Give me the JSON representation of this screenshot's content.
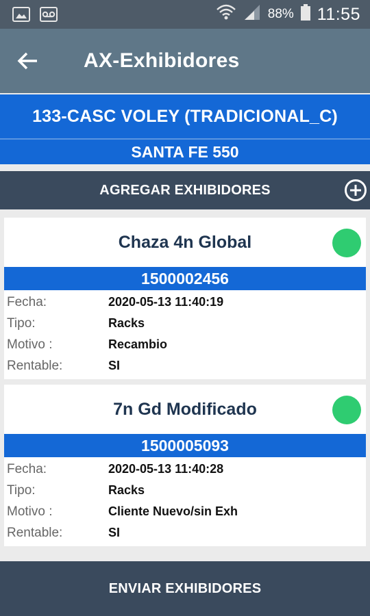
{
  "status_bar": {
    "battery": "88%",
    "time": "11:55"
  },
  "app_bar": {
    "title": "AX-Exhibidores"
  },
  "client": {
    "name": "133-CASC VOLEY (TRADICIONAL_C)",
    "address": "SANTA FE 550"
  },
  "add_bar": {
    "label": "AGREGAR EXHIBIDORES"
  },
  "labels": {
    "fecha": "Fecha:",
    "tipo": "Tipo:",
    "motivo": "Motivo :",
    "rentable": "Rentable:"
  },
  "exhibitors": [
    {
      "name": "Chaza 4n Global",
      "code": "1500002456",
      "fecha": "2020-05-13 11:40:19",
      "tipo": "Racks",
      "motivo": "Recambio",
      "rentable": "SI",
      "status_color": "#2fcc71"
    },
    {
      "name": "7n Gd Modificado",
      "code": "1500005093",
      "fecha": "2020-05-13 11:40:28",
      "tipo": "Racks",
      "motivo": "Cliente Nuevo/sin Exh",
      "rentable": "SI",
      "status_color": "#2fcc71"
    }
  ],
  "send_button": {
    "label": "ENVIAR EXHIBIDORES"
  }
}
